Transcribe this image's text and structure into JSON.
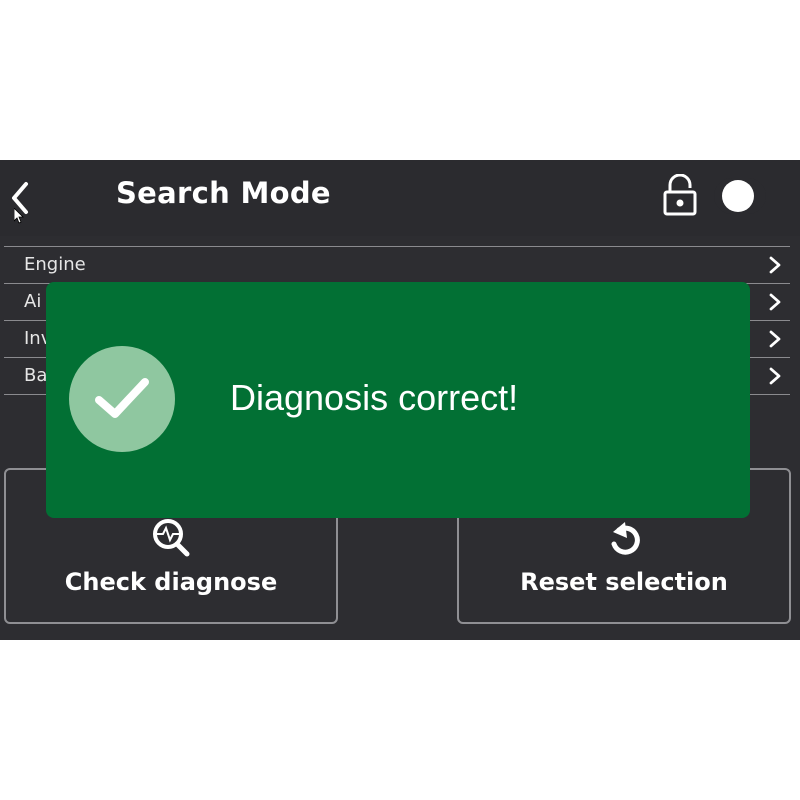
{
  "header": {
    "title": "Search Mode",
    "back_icon": "chevron-left-icon",
    "lock_icon": "unlock-icon",
    "toggle_state": "on"
  },
  "list": {
    "items": [
      {
        "label": "Engine"
      },
      {
        "label": "Ai"
      },
      {
        "label": "Inv"
      },
      {
        "label": "Ba"
      }
    ]
  },
  "actions": {
    "check_label": "Check diagnose",
    "check_icon": "magnify-diagnose-icon",
    "reset_label": "Reset selection",
    "reset_icon": "reset-icon"
  },
  "toast": {
    "message": "Diagnosis correct!",
    "icon": "checkmark-circle-icon"
  },
  "colors": {
    "screen_bg": "#2d2d31",
    "toast_bg": "#027034",
    "check_circle": "#8fc7a0",
    "divider": "#8a8a8e"
  }
}
